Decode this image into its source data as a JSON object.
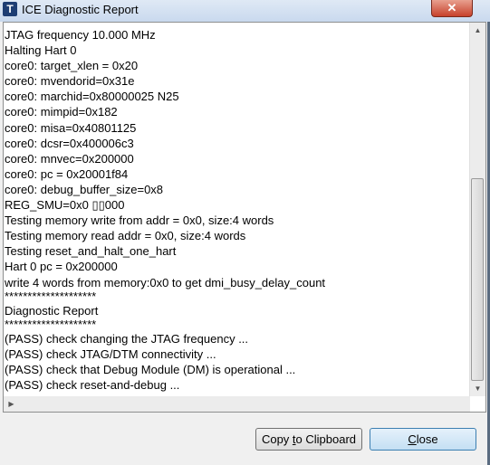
{
  "window": {
    "title": "ICE Diagnostic Report",
    "close_glyph": "✕",
    "icon_letter": "T"
  },
  "log_lines": [
    "JTAG frequency 10.000 MHz",
    "Halting Hart 0",
    "core0: target_xlen = 0x20",
    "core0: mvendorid=0x31e",
    "core0: marchid=0x80000025 N25",
    "core0: mimpid=0x182",
    "core0: misa=0x40801125",
    "core0: dcsr=0x400006c3",
    "core0: mnvec=0x200000",
    "core0: pc = 0x20001f84",
    "core0: debug_buffer_size=0x8",
    "REG_SMU=0x0 ▯▯000",
    "Testing memory write from addr = 0x0, size:4 words",
    "Testing memory read addr = 0x0, size:4 words",
    "Testing reset_and_halt_one_hart",
    "Hart 0 pc = 0x200000",
    "write 4 words from memory:0x0 to get dmi_busy_delay_count",
    "********************",
    "Diagnostic Report",
    "********************",
    "(PASS) check changing the JTAG frequency ...",
    "(PASS) check JTAG/DTM connectivity ...",
    "(PASS) check that Debug Module (DM) is operational ...",
    "(PASS) check reset-and-debug ..."
  ],
  "buttons": {
    "copy_pre": "Copy ",
    "copy_u": "t",
    "copy_post": "o Clipboard",
    "close_u": "C",
    "close_post": "lose"
  },
  "scroll": {
    "up": "▲",
    "down": "▼",
    "right": "▶"
  }
}
